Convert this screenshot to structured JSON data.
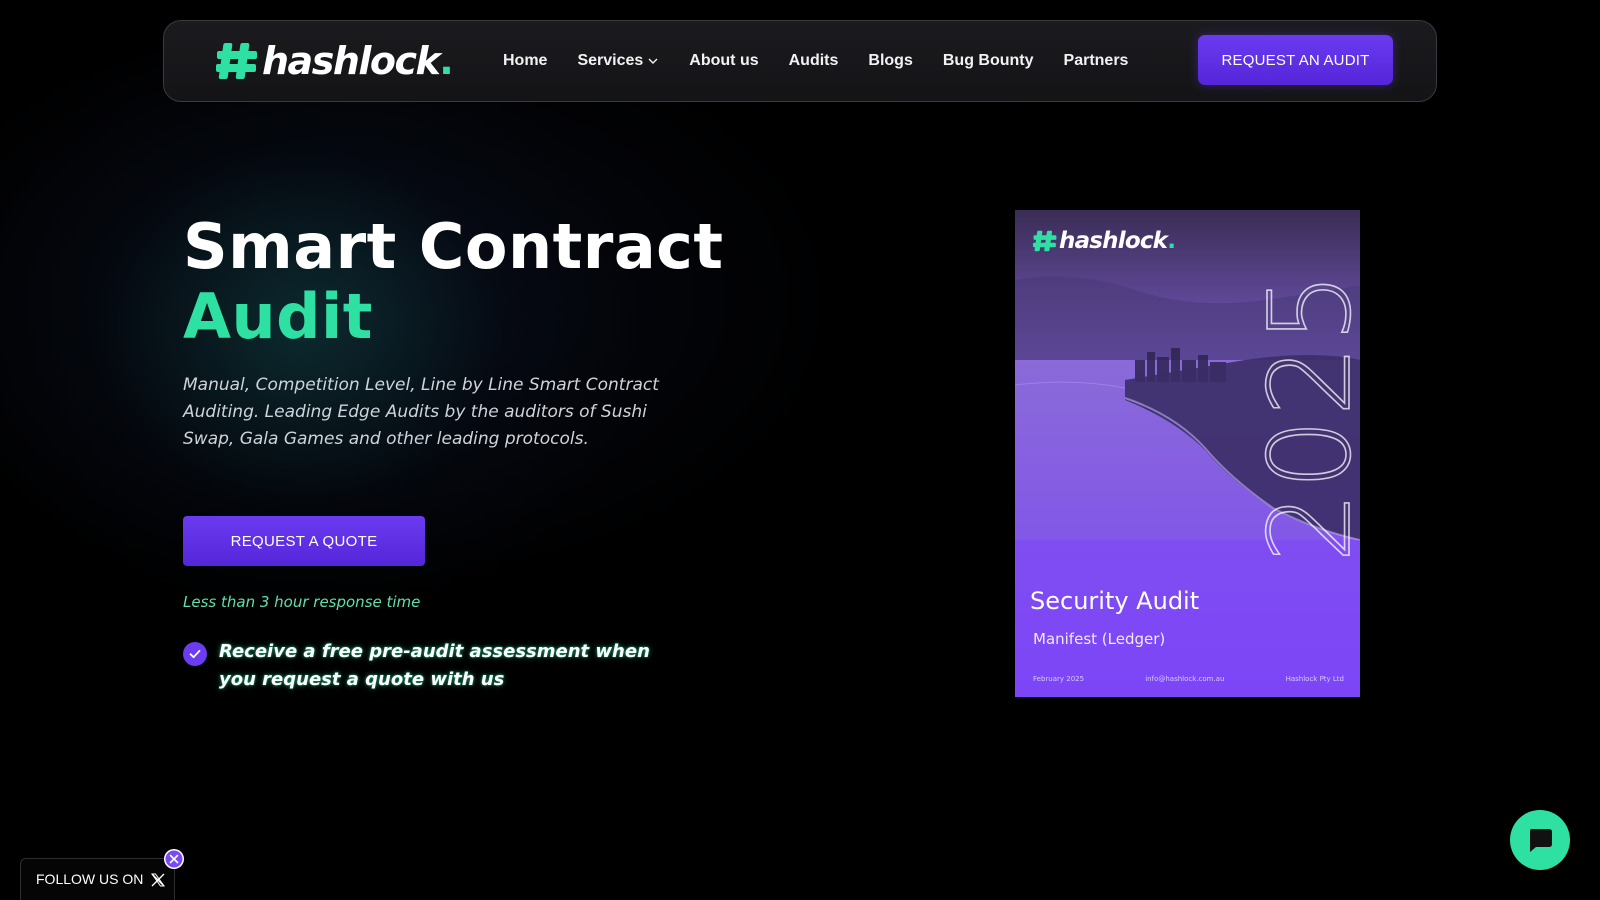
{
  "colors": {
    "accent_green": "#2fe0a3",
    "accent_purple": "#6a3bf0",
    "background": "#000000"
  },
  "brand": {
    "name": "hashlock",
    "dot": ".",
    "icon": "hash-logo-icon"
  },
  "nav": {
    "items": [
      {
        "label": "Home"
      },
      {
        "label": "Services",
        "icon": "chevron-down-icon"
      },
      {
        "label": "About us"
      },
      {
        "label": "Audits"
      },
      {
        "label": "Blogs"
      },
      {
        "label": "Bug Bounty"
      },
      {
        "label": "Partners"
      }
    ],
    "cta_label": "REQUEST AN AUDIT"
  },
  "hero": {
    "title_line1": "Smart Contract",
    "title_line2": "Audit",
    "subtitle": "Manual, Competition Level, Line by Line Smart Contract Auditing. Leading Edge Audits by the auditors of Sushi Swap, Gala Games and other leading protocols.",
    "cta_label": "REQUEST A QUOTE",
    "response_note": "Less than 3 hour response time",
    "benefit": "Receive a free pre-audit assessment when you request a quote with us",
    "benefit_icon": "check-circle-icon"
  },
  "report_cover": {
    "brand": "hashlock",
    "year": "2025",
    "title": "Security Audit",
    "subtitle": "Manifest (Ledger)",
    "footer_date": "February 2025",
    "footer_email": "info@hashlock.com.au",
    "footer_company": "Hashlock Pty Ltd"
  },
  "follow": {
    "label": "FOLLOW US ON",
    "icon": "x-logo-icon",
    "close_icon": "close-icon"
  },
  "chat": {
    "icon": "chat-bubble-icon"
  }
}
